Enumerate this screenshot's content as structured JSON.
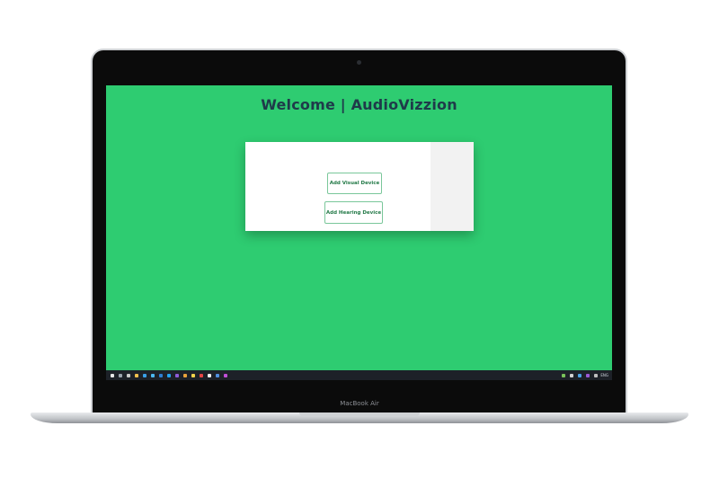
{
  "device": {
    "brand_label": "MacBook Air"
  },
  "app": {
    "title": "Welcome | AudioVizzion",
    "background_color": "#2ecc71"
  },
  "card": {
    "buttons": {
      "add_visual": "Add Visual Device",
      "add_hearing": "Add Hearing Device"
    }
  },
  "taskbar": {
    "language": "ENG",
    "icons": [
      "start-icon",
      "search-icon",
      "task-view-icon",
      "file-explorer-icon",
      "edge-icon",
      "store-icon",
      "mail-icon",
      "vscode-icon",
      "visual-studio-icon",
      "app-icon",
      "notes-icon",
      "media-icon",
      "github-icon",
      "terminal-icon",
      "settings-icon"
    ],
    "tray_icons": [
      "network-icon",
      "volume-icon",
      "battery-icon",
      "onedrive-icon",
      "notification-icon"
    ]
  }
}
